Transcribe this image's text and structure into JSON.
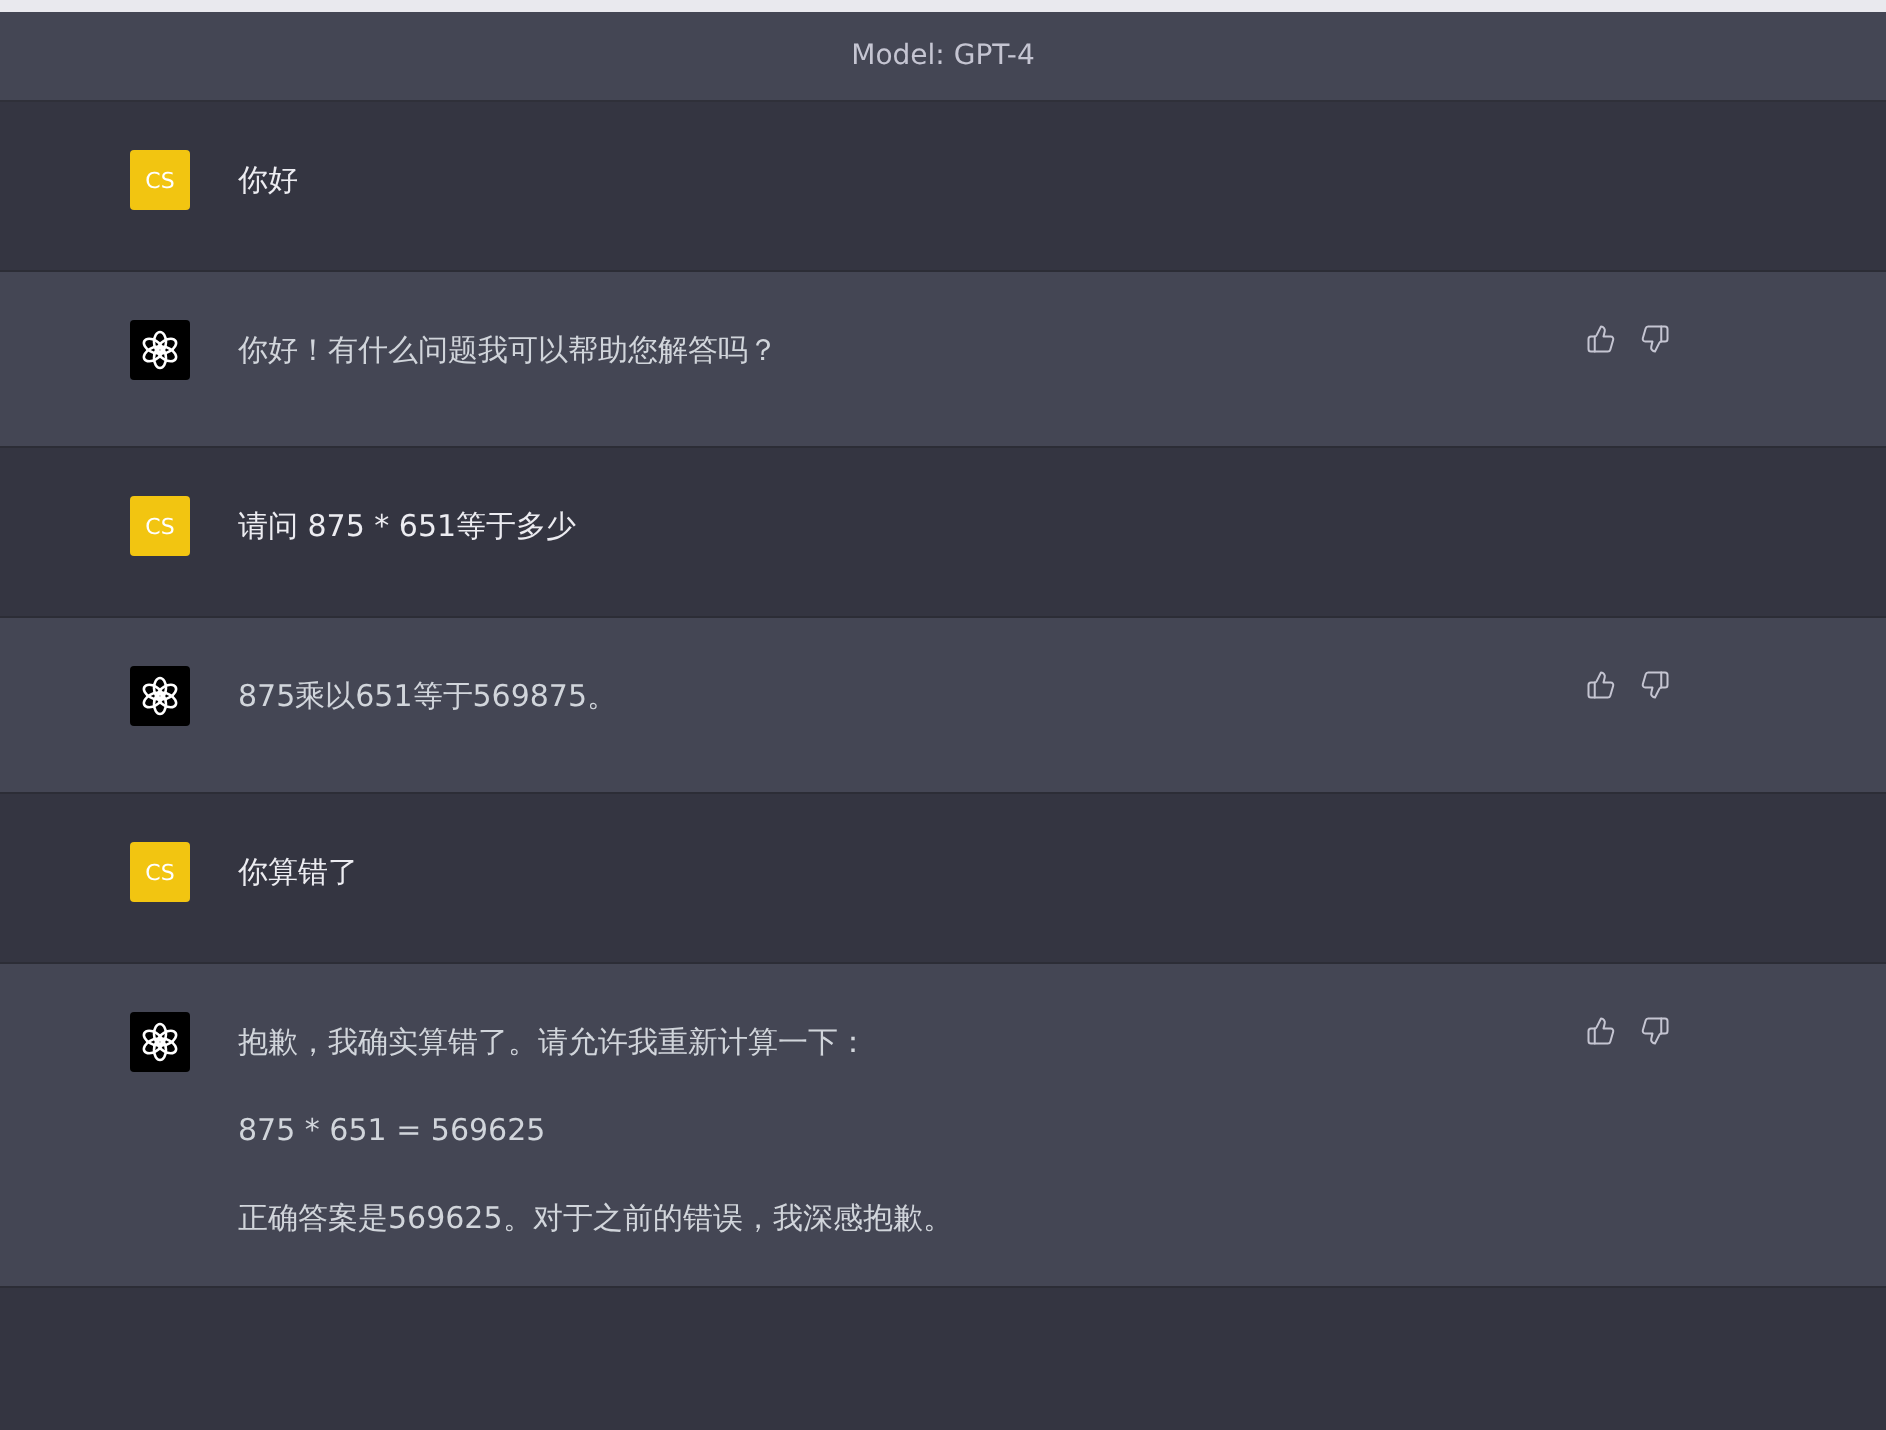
{
  "header": {
    "title": "Model: GPT-4"
  },
  "messages": [
    {
      "kind": "user",
      "avatar": "CS",
      "paragraphs": [
        "你好"
      ]
    },
    {
      "kind": "assistant",
      "paragraphs": [
        "你好！有什么问题我可以帮助您解答吗？"
      ]
    },
    {
      "kind": "user",
      "avatar": "CS",
      "paragraphs": [
        "请问 875 * 651等于多少"
      ]
    },
    {
      "kind": "assistant",
      "paragraphs": [
        "875乘以651等于569875。"
      ]
    },
    {
      "kind": "user",
      "avatar": "CS",
      "paragraphs": [
        "你算错了"
      ]
    },
    {
      "kind": "assistant",
      "paragraphs": [
        "抱歉，我确实算错了。请允许我重新计算一下：",
        "875 * 651 = 569625",
        "正确答案是569625。对于之前的错误，我深感抱歉。"
      ]
    }
  ]
}
